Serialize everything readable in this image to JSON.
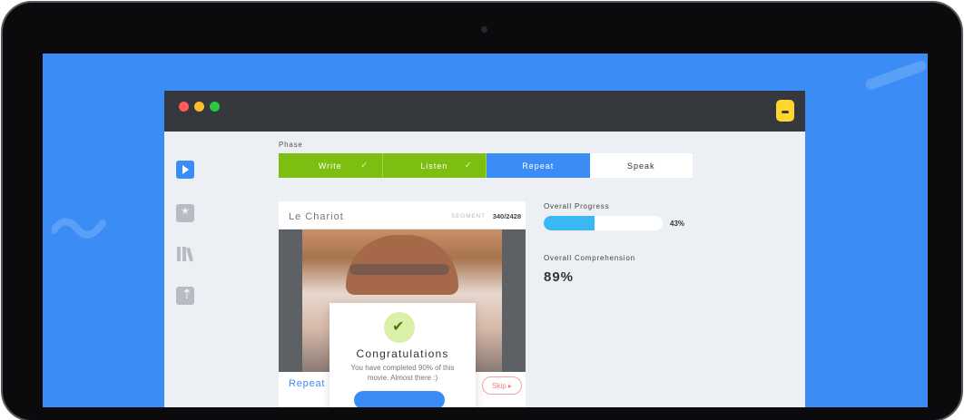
{
  "phase": {
    "label": "Phase",
    "steps": [
      {
        "label": "Write",
        "state": "done"
      },
      {
        "label": "Listen",
        "state": "done"
      },
      {
        "label": "Repeat",
        "state": "active"
      },
      {
        "label": "Speak",
        "state": "todo"
      }
    ],
    "check_glyph": "✓"
  },
  "video": {
    "title": "Le Chariot",
    "segment_label": "SEGMENT",
    "segment_count": "340/2428",
    "current_mode": "Repeat",
    "skip_label": "Skip ▸"
  },
  "modal": {
    "title": "Congratulations",
    "message": "You have completed 90% of this movie. Almost there :)"
  },
  "progress": {
    "label": "Overall Progress",
    "value_text": "43%",
    "fraction": 0.43
  },
  "comprehension": {
    "label": "Overall Comprehension",
    "value_text": "89%"
  },
  "icons": {
    "sidebar": [
      "play-icon",
      "bookmark-icon",
      "library-icon",
      "upload-icon"
    ],
    "logo": "app-logo-icon"
  },
  "colors": {
    "accent_blue": "#3b8cf4",
    "done_green": "#7cbf10",
    "progress_blue": "#3bb8f4",
    "titlebar": "#35393d"
  }
}
